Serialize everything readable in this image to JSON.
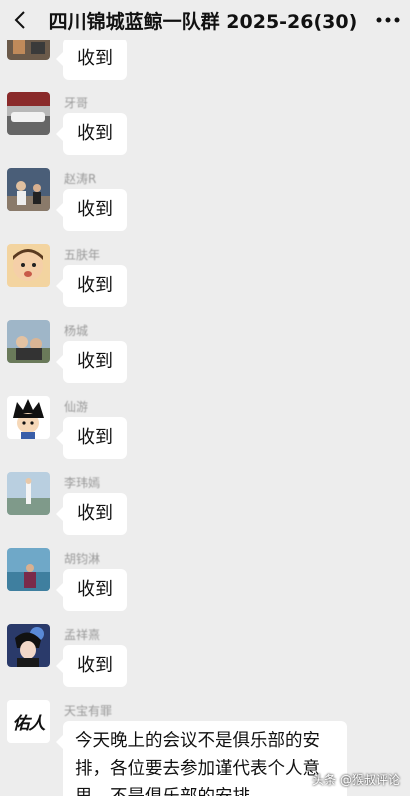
{
  "header": {
    "title": "四川锦城蓝鲸一队群 2025-26(30)",
    "back_icon": "back-arrow-icon",
    "more_icon": "more-dots-icon"
  },
  "messages": [
    {
      "sender": "",
      "text": "收到"
    },
    {
      "sender": "牙哥",
      "text": "收到"
    },
    {
      "sender": "赵涛R",
      "text": "收到"
    },
    {
      "sender": "五肤年",
      "text": "收到"
    },
    {
      "sender": "杨城",
      "text": "收到"
    },
    {
      "sender": "仙游",
      "text": "收到"
    },
    {
      "sender": "李玮嫣",
      "text": "收到"
    },
    {
      "sender": "胡钧淋",
      "text": "收到"
    },
    {
      "sender": "孟祥熹",
      "text": "收到"
    },
    {
      "sender": "天宝有罪",
      "text": "今天晚上的会议不是俱乐部的安排，各位要去参加谨代表个人意思，不是俱乐部的安排。",
      "avatar_text": "佑人"
    }
  ],
  "watermark": "头条 @猴叔评论"
}
